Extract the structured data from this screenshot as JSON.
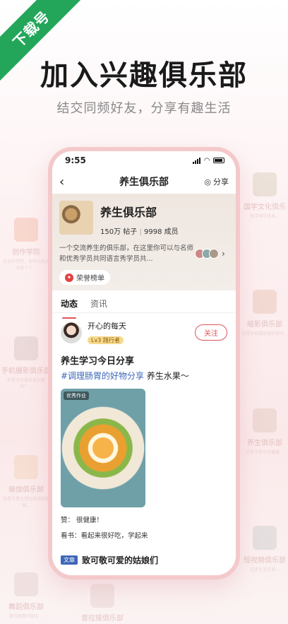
{
  "corner_badge": "下载号",
  "hero": {
    "title": "加入兴趣俱乐部",
    "subtitle": "结交同频好友，分享有趣生活"
  },
  "background_clubs": {
    "left": [
      {
        "name": "创作学院",
        "desc": "在创作学院，你可以找到无数个人..."
      },
      {
        "name": "手机摄影俱乐部",
        "desc": "你是手机摄影爱好者吗？..."
      },
      {
        "name": "瑜伽俱乐部",
        "desc": "你是不是也想优雅地和瑜伽..."
      },
      {
        "name": "舞蹈俱乐部",
        "desc": "喜欢跳舞的朋友..."
      }
    ],
    "right": [
      {
        "name": "国学文化俱乐",
        "desc": "想学国学经典..."
      },
      {
        "name": "暗影俱乐部",
        "desc": "你是手机摄影爱好者吗..."
      },
      {
        "name": "养生俱乐部",
        "desc": "你是不是也想健康..."
      },
      {
        "name": "短视频俱乐部",
        "desc": "记录生活点滴..."
      }
    ],
    "bottom": [
      {
        "name": "音拉接俱乐部"
      }
    ]
  },
  "status_bar": {
    "time": "9:55"
  },
  "nav": {
    "back_icon": "‹",
    "title": "养生俱乐部",
    "share_label": "分享"
  },
  "club": {
    "name": "养生俱乐部",
    "posts_count": "150万",
    "posts_label": "帖子",
    "members_count": "9998",
    "members_label": "成员",
    "description": "一个交流养生的俱乐部，在这里你可以与名师和优秀学员共同语言秀学员共...",
    "honor_label": "荣誉榜单"
  },
  "tabs": [
    {
      "label": "动态",
      "active": true
    },
    {
      "label": "资讯",
      "active": false
    }
  ],
  "post": {
    "author": "开心的每天",
    "level": "Lv3 践行者",
    "follow_label": "关注",
    "title": "养生学习今日分享",
    "tag": "#调理肠胃的好物分享",
    "text": " 养生水果～",
    "image_badge": "优秀作业",
    "comment1": "赞：  很健康！",
    "comment2": "看书：看起来很好吃，学起来"
  },
  "article": {
    "label": "文章",
    "title": "致可敬可爱的姑娘们"
  },
  "colors": {
    "accent": "#e0555a",
    "tag": "#3d68b8",
    "phone_border": "#f4c9cb",
    "corner": "#23a65a"
  }
}
